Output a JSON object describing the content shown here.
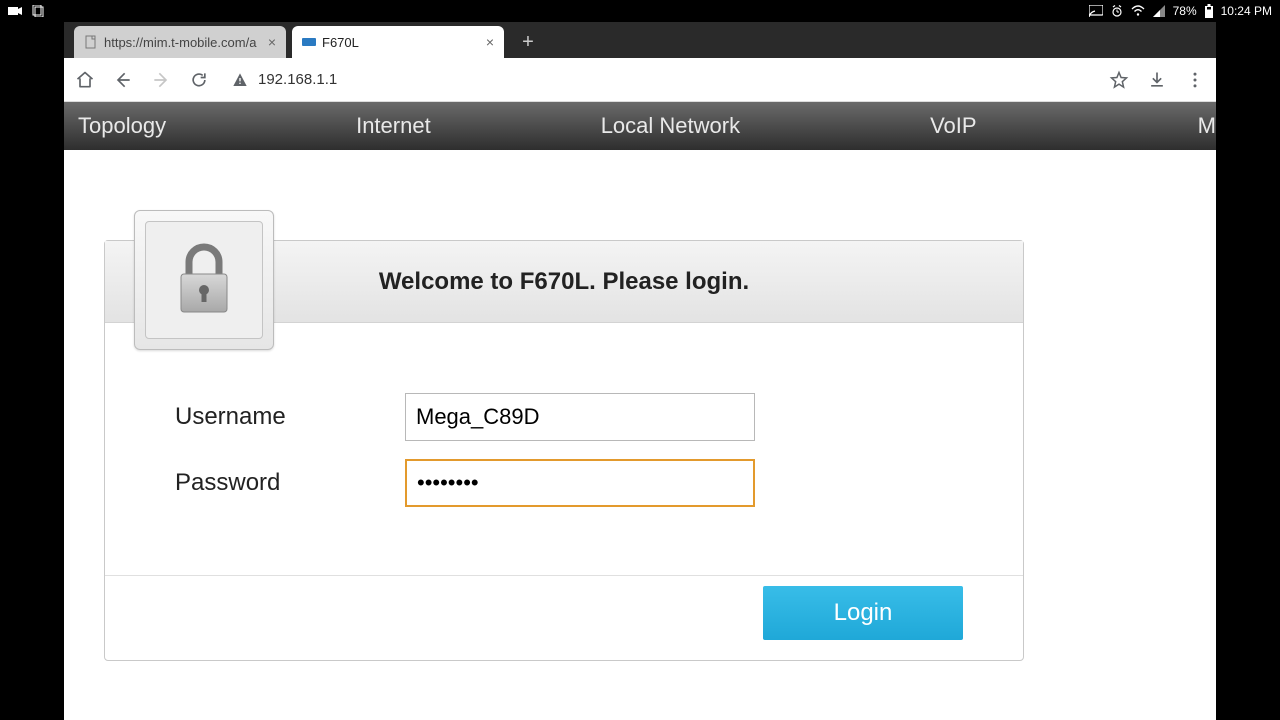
{
  "status": {
    "battery": "78%",
    "time": "10:24 PM"
  },
  "tabs": [
    {
      "title": "https://mim.t-mobile.com/a",
      "active": false
    },
    {
      "title": "F670L",
      "active": true
    }
  ],
  "omnibox": {
    "url": "192.168.1.1"
  },
  "router_nav": {
    "items": [
      "Topology",
      "Internet",
      "Local Network",
      "VoIP",
      "M"
    ]
  },
  "login": {
    "welcome": "Welcome to F670L. Please login.",
    "username_label": "Username",
    "password_label": "Password",
    "username_value": "Mega_C89D",
    "password_value": "••••••••",
    "login_button": "Login"
  }
}
